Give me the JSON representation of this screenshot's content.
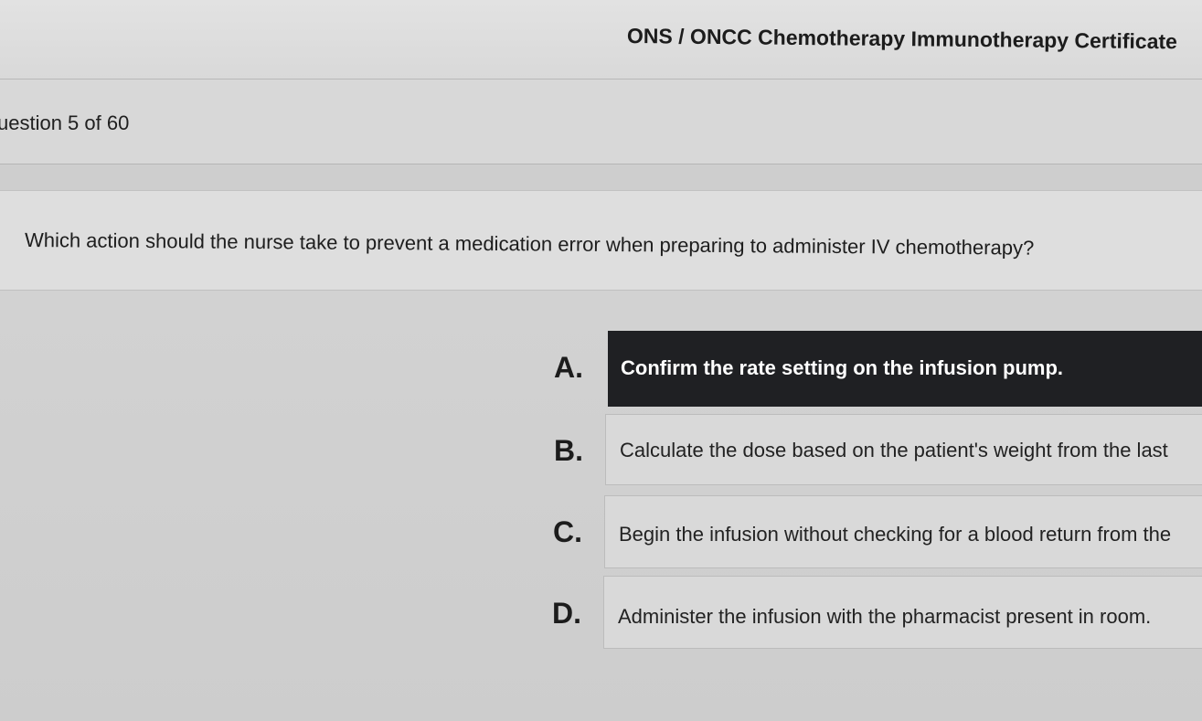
{
  "header": {
    "title": "ONS / ONCC Chemotherapy Immunotherapy Certificate"
  },
  "progress": {
    "question_counter": "uestion 5 of 60"
  },
  "question": {
    "text": "Which action should the nurse take to prevent a medication error when preparing to administer IV chemotherapy?"
  },
  "options": [
    {
      "letter": "A.",
      "text": "Confirm the rate setting on the infusion pump.",
      "selected": true
    },
    {
      "letter": "B.",
      "text": "Calculate the dose based on the patient's weight from the last",
      "selected": false
    },
    {
      "letter": "C.",
      "text": "Begin the infusion without checking for a blood return from the",
      "selected": false
    },
    {
      "letter": "D.",
      "text": "Administer the infusion with the pharmacist present in room.",
      "selected": false
    }
  ],
  "colors": {
    "selected_option_background": "#1f2023",
    "selected_option_text": "#ffffff"
  }
}
